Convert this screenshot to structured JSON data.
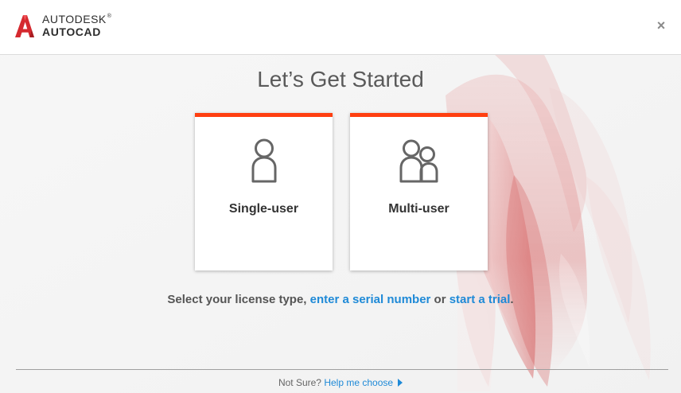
{
  "header": {
    "brand_top": "AUTODESK",
    "brand_bottom": "AUTOCAD",
    "registered_mark": "®",
    "close_label": "×",
    "logo_icon": "autocad-a-logo-icon"
  },
  "main": {
    "title": "Let’s Get Started",
    "cards": [
      {
        "label": "Single-user",
        "icon": "single-user-icon"
      },
      {
        "label": "Multi-user",
        "icon": "multi-user-icon"
      }
    ],
    "license_prefix": "Select your license type, ",
    "serial_link": "enter a serial number",
    "license_middle": " or ",
    "trial_link": "start a trial",
    "license_suffix": "."
  },
  "footer": {
    "prompt": "Not Sure? ",
    "help_link": "Help me choose",
    "arrow_icon": "play-right-icon"
  },
  "colors": {
    "accent": "#ff3f10",
    "link": "#1f8ad7",
    "title": "#5a5a5a",
    "text": "#333333"
  }
}
